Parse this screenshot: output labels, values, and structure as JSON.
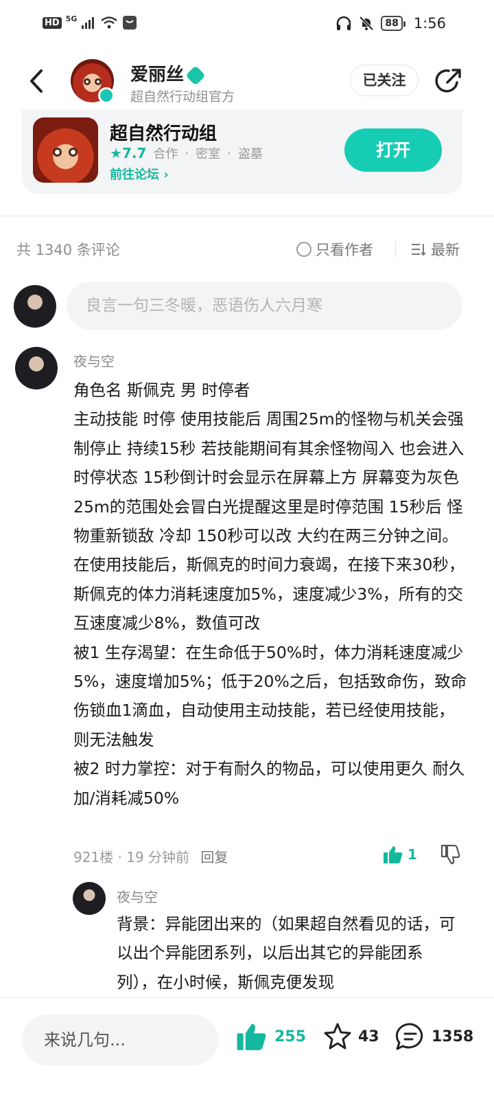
{
  "status_bar": {
    "hd": "HD",
    "network": "5G",
    "battery": "88",
    "time": "1:56"
  },
  "header": {
    "author_name": "爱丽丝",
    "author_subtitle": "超自然行动组官方",
    "follow_label": "已关注"
  },
  "game_card": {
    "title": "超自然行动组",
    "rating": "7.7",
    "tags": [
      "合作",
      "密室",
      "盗墓"
    ],
    "forum_link": "前往论坛",
    "open_label": "打开"
  },
  "comments_bar": {
    "count_text": "共 1340 条评论",
    "only_author_label": "只看作者",
    "sort_label": "最新"
  },
  "comment_input": {
    "placeholder": "良言一句三冬暖，恶语伤人六月寒"
  },
  "comment": {
    "user": "夜与空",
    "lines": [
      "角色名 斯佩克 男 时停者",
      "主动技能 时停 使用技能后 周围25m的怪物与机关会强制停止 持续15秒 若技能期间有其余怪物闯入 也会进入时停状态 15秒倒计时会显示在屏幕上方 屏幕变为灰色 25m的范围处会冒白光提醒这里是时停范围 15秒后 怪物重新锁敌 冷却 150秒可以改 大约在两三分钟之间。在使用技能后，斯佩克的时间力衰竭，在接下来30秒，斯佩克的体力消耗速度加5%，速度减少3%，所有的交互速度减少8%，数值可改",
      "被1 生存渴望：在生命低于50%时，体力消耗速度减少5%，速度增加5%；低于20%之后，包括致命伤，致命伤锁血1滴血，自动使用主动技能，若已经使用技能，则无法触发",
      "被2 时力掌控：对于有耐久的物品，可以使用更久 耐久加/消耗减50%"
    ],
    "floor_time": "921楼 · 19 分钟前",
    "reply_label": "回复",
    "likes": "1"
  },
  "reply": {
    "user": "夜与空",
    "text": "背景：异能团出来的（如果超自然看见的话，可以出个异能团系列，以后出其它的异能团系列），在小时候，斯佩克便发现"
  },
  "bottom_bar": {
    "input_placeholder": "来说几句...",
    "likes": "255",
    "stars": "43",
    "comments": "1358"
  },
  "colors": {
    "accent": "#16cdb4",
    "accent_text": "#14b89f"
  }
}
